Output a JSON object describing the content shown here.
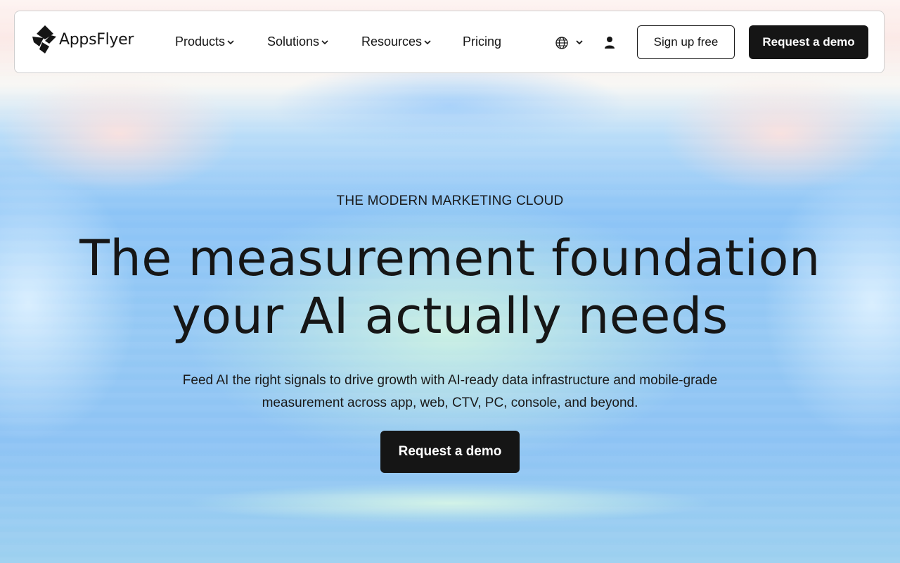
{
  "brand": {
    "name": "AppsFlyer"
  },
  "nav": {
    "items": [
      {
        "label": "Products",
        "has_dropdown": true
      },
      {
        "label": "Solutions",
        "has_dropdown": true
      },
      {
        "label": "Resources",
        "has_dropdown": true
      },
      {
        "label": "Pricing",
        "has_dropdown": false
      }
    ],
    "language_icon": "globe-icon",
    "account_icon": "user-icon",
    "signup_label": "Sign up free",
    "demo_label": "Request a demo"
  },
  "hero": {
    "eyebrow": "THE MODERN MARKETING CLOUD",
    "headline_line1": "The measurement foundation",
    "headline_line2": "your AI actually needs",
    "subtitle_line1": "Feed AI the right signals to drive growth with AI-ready data infrastructure and mobile-grade",
    "subtitle_line2": "measurement across app, web, CTV, PC, console, and beyond.",
    "cta_label": "Request a demo"
  },
  "colors": {
    "primary_dark": "#151515",
    "nav_background": "#ffffff",
    "hero_sky_blue": "#8ec3f5",
    "hero_mint": "#cdf2e2"
  }
}
